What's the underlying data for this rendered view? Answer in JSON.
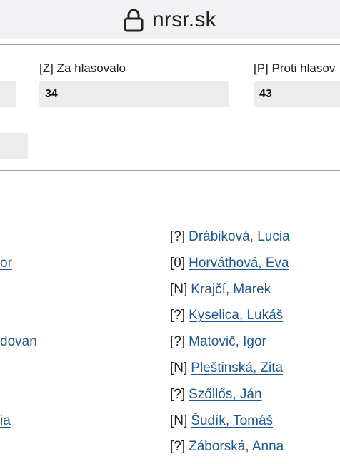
{
  "browser": {
    "domain": "nrsr.sk",
    "lock_icon": "lock-icon"
  },
  "stats": {
    "za": {
      "label": "[Z] Za hlasovalo",
      "value": "34"
    },
    "proti": {
      "label": "[P] Proti hlasov",
      "value": "43"
    },
    "left_value": "",
    "lower_value": ""
  },
  "left_column": [
    {
      "name": "or"
    },
    {
      "name": "dovan"
    },
    {
      "name": "ia"
    }
  ],
  "right_column": [
    {
      "vote": "[?]",
      "name": "Drábiková, Lucia"
    },
    {
      "vote": "[0]",
      "name": "Horváthová, Eva"
    },
    {
      "vote": "[N]",
      "name": "Krajčí, Marek"
    },
    {
      "vote": "[?]",
      "name": "Kyselica, Lukáš"
    },
    {
      "vote": "[?]",
      "name": "Matovič, Igor"
    },
    {
      "vote": "[N]",
      "name": "Pleštinská, Zita"
    },
    {
      "vote": "[?]",
      "name": "Szőllős, Ján"
    },
    {
      "vote": "[N]",
      "name": "Šudík, Tomáš"
    },
    {
      "vote": "[?]",
      "name": "Záborská, Anna"
    }
  ]
}
